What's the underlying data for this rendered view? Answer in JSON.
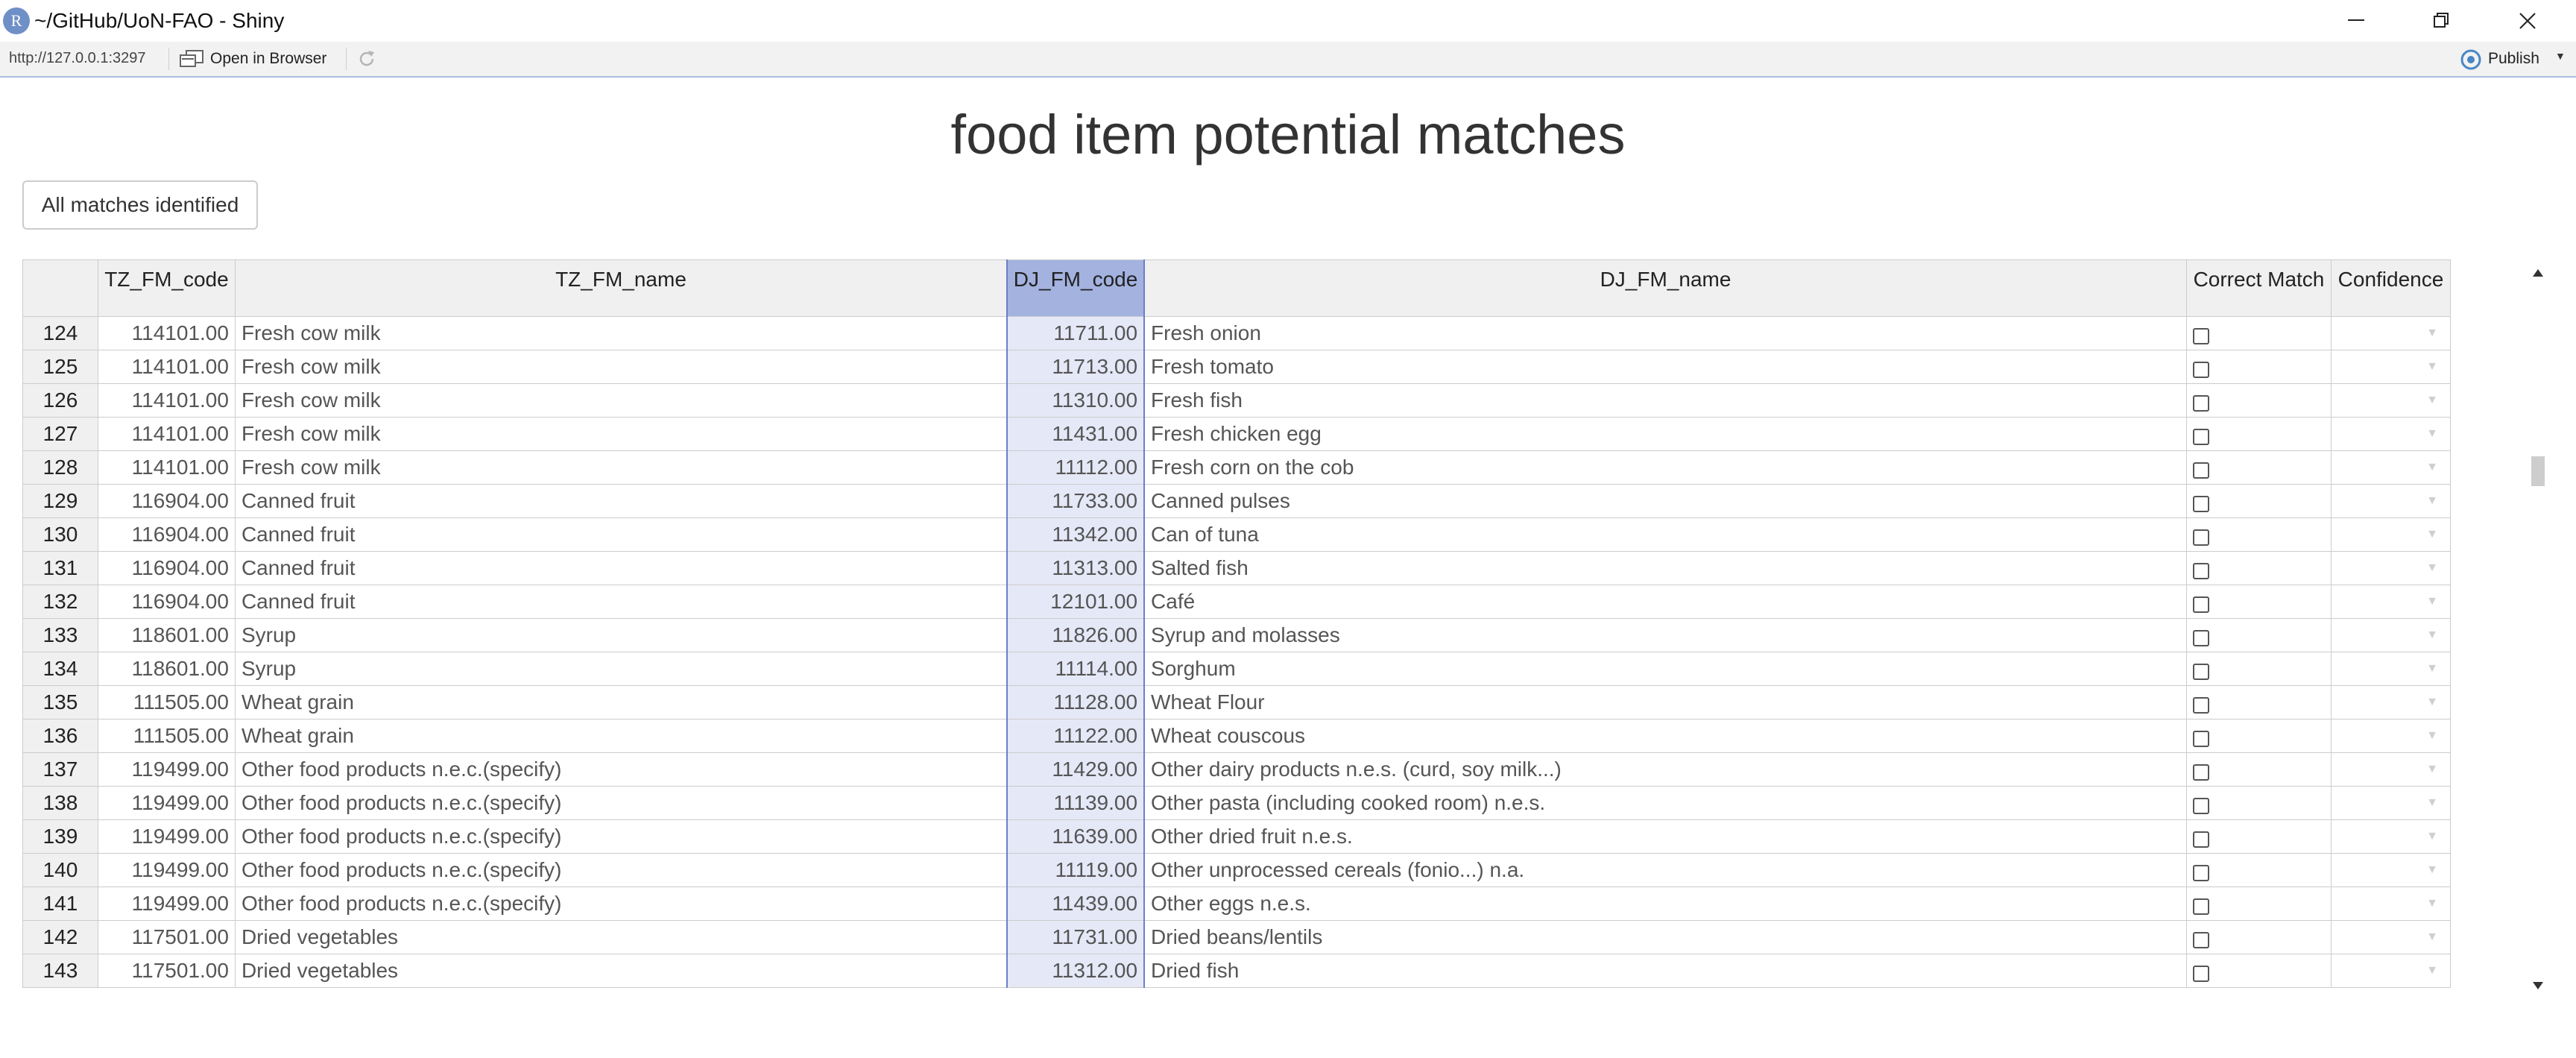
{
  "window": {
    "logo_letter": "R",
    "title": "~/GitHub/UoN-FAO - Shiny"
  },
  "toolbar": {
    "url": "http://127.0.0.1:3297",
    "open_in_browser": "Open in Browser",
    "publish": "Publish"
  },
  "page": {
    "title": "food item potential matches",
    "all_matches_button": "All matches identified"
  },
  "table": {
    "columns": [
      "TZ_FM_code",
      "TZ_FM_name",
      "DJ_FM_code",
      "DJ_FM_name",
      "Correct Match",
      "Confidence"
    ],
    "selected_column": "DJ_FM_code",
    "rows": [
      {
        "row": "124",
        "tz_code": "114101.00",
        "tz_name": "Fresh cow milk",
        "dj_code": "11711.00",
        "dj_name": "Fresh onion"
      },
      {
        "row": "125",
        "tz_code": "114101.00",
        "tz_name": "Fresh cow milk",
        "dj_code": "11713.00",
        "dj_name": "Fresh tomato"
      },
      {
        "row": "126",
        "tz_code": "114101.00",
        "tz_name": "Fresh cow milk",
        "dj_code": "11310.00",
        "dj_name": "Fresh fish"
      },
      {
        "row": "127",
        "tz_code": "114101.00",
        "tz_name": "Fresh cow milk",
        "dj_code": "11431.00",
        "dj_name": "Fresh chicken egg"
      },
      {
        "row": "128",
        "tz_code": "114101.00",
        "tz_name": "Fresh cow milk",
        "dj_code": "11112.00",
        "dj_name": "Fresh corn on the cob"
      },
      {
        "row": "129",
        "tz_code": "116904.00",
        "tz_name": "Canned fruit",
        "dj_code": "11733.00",
        "dj_name": "Canned pulses"
      },
      {
        "row": "130",
        "tz_code": "116904.00",
        "tz_name": "Canned fruit",
        "dj_code": "11342.00",
        "dj_name": "Can of tuna"
      },
      {
        "row": "131",
        "tz_code": "116904.00",
        "tz_name": "Canned fruit",
        "dj_code": "11313.00",
        "dj_name": "Salted fish"
      },
      {
        "row": "132",
        "tz_code": "116904.00",
        "tz_name": "Canned fruit",
        "dj_code": "12101.00",
        "dj_name": "Café"
      },
      {
        "row": "133",
        "tz_code": "118601.00",
        "tz_name": "Syrup",
        "dj_code": "11826.00",
        "dj_name": "Syrup and molasses"
      },
      {
        "row": "134",
        "tz_code": "118601.00",
        "tz_name": "Syrup",
        "dj_code": "11114.00",
        "dj_name": "Sorghum"
      },
      {
        "row": "135",
        "tz_code": "111505.00",
        "tz_name": "Wheat grain",
        "dj_code": "11128.00",
        "dj_name": "Wheat Flour"
      },
      {
        "row": "136",
        "tz_code": "111505.00",
        "tz_name": "Wheat grain",
        "dj_code": "11122.00",
        "dj_name": "Wheat couscous"
      },
      {
        "row": "137",
        "tz_code": "119499.00",
        "tz_name": "Other food products n.e.c.(specify)",
        "dj_code": "11429.00",
        "dj_name": "Other dairy products n.e.s. (curd, soy milk...)"
      },
      {
        "row": "138",
        "tz_code": "119499.00",
        "tz_name": "Other food products n.e.c.(specify)",
        "dj_code": "11139.00",
        "dj_name": "Other pasta (including cooked room) n.e.s."
      },
      {
        "row": "139",
        "tz_code": "119499.00",
        "tz_name": "Other food products n.e.c.(specify)",
        "dj_code": "11639.00",
        "dj_name": "Other dried fruit n.e.s."
      },
      {
        "row": "140",
        "tz_code": "119499.00",
        "tz_name": "Other food products n.e.c.(specify)",
        "dj_code": "11119.00",
        "dj_name": "Other unprocessed cereals (fonio...) n.a."
      },
      {
        "row": "141",
        "tz_code": "119499.00",
        "tz_name": "Other food products n.e.c.(specify)",
        "dj_code": "11439.00",
        "dj_name": "Other eggs n.e.s."
      },
      {
        "row": "142",
        "tz_code": "117501.00",
        "tz_name": "Dried vegetables",
        "dj_code": "11731.00",
        "dj_name": "Dried beans/lentils"
      },
      {
        "row": "143",
        "tz_code": "117501.00",
        "tz_name": "Dried vegetables",
        "dj_code": "11312.00",
        "dj_name": "Dried fish"
      }
    ]
  },
  "icons": {
    "minimize": "minimize-icon",
    "maximize": "restore-icon",
    "close": "close-icon",
    "open_in_browser": "external-window-icon",
    "refresh": "refresh-icon",
    "publish": "publish-icon",
    "dropdown": "dropdown-arrow-icon"
  },
  "colors": {
    "selected_column_header": "#a3b2df",
    "selected_column_cells": "#e5e8f7",
    "selected_column_border": "#6b7fc6",
    "header_bg": "#f0f0f0"
  }
}
